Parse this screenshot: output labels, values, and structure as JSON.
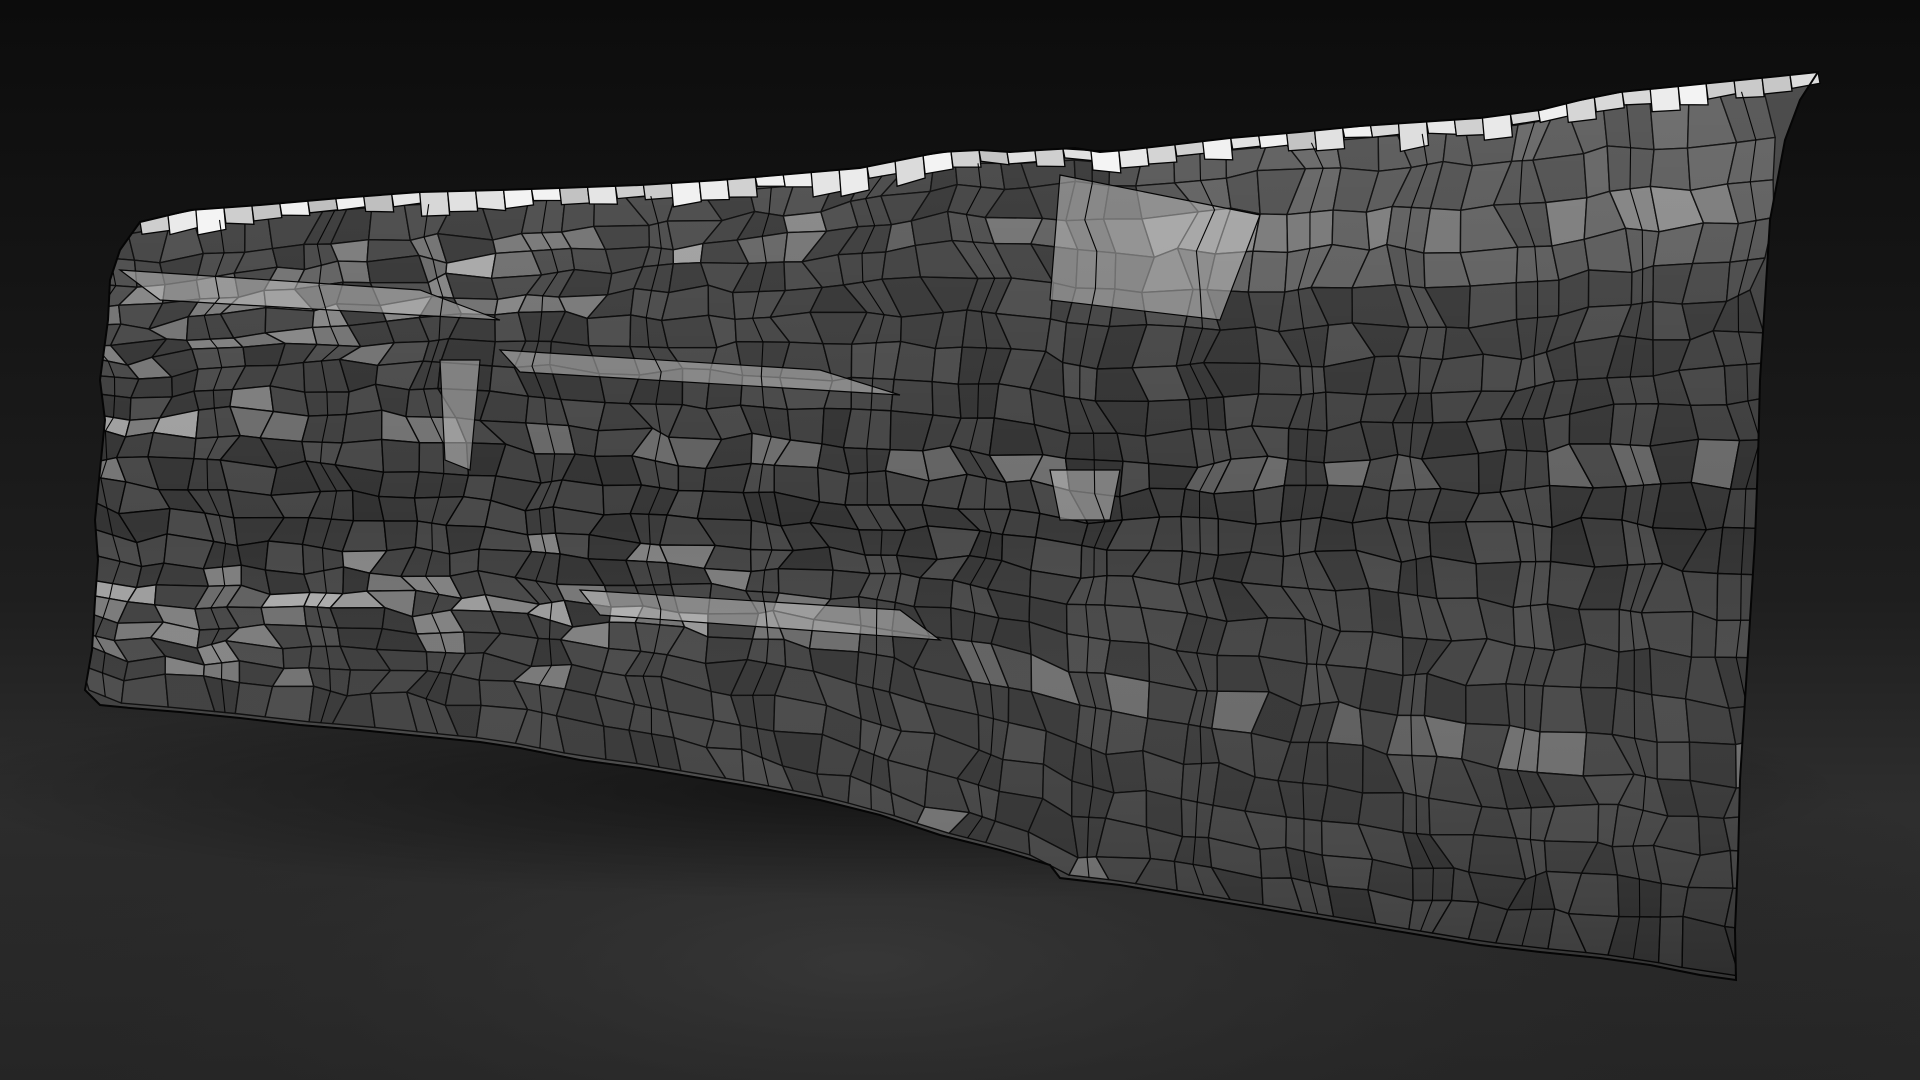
{
  "scene": {
    "subject": "wireframe-rock-wall",
    "colors": {
      "backdrop_top": "#0d0d0d",
      "backdrop_floor": "#2f2f2f",
      "face_dark": "#3a3a3a",
      "face_mid": "#4d4d4d",
      "face_light": "#8a8a8a",
      "top_highlight": "#e8e8e8",
      "wire": "#050505"
    }
  }
}
